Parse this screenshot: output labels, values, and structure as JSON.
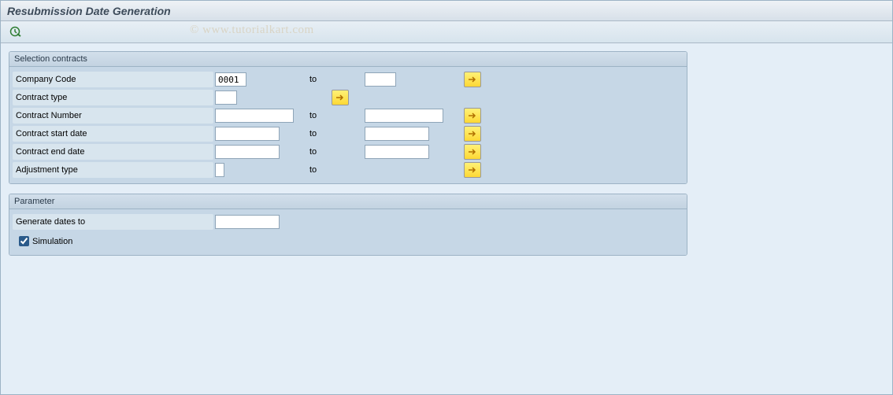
{
  "title": "Resubmission Date Generation",
  "watermark": "© www.tutorialkart.com",
  "groups": {
    "selection": {
      "header": "Selection contracts",
      "fields": {
        "companyCode": {
          "label": "Company Code",
          "from": "0001",
          "to_label": "to",
          "to": ""
        },
        "contractType": {
          "label": "Contract type",
          "from": ""
        },
        "contractNumber": {
          "label": "Contract Number",
          "from": "",
          "to_label": "to",
          "to": ""
        },
        "contractStart": {
          "label": "Contract start date",
          "from": "",
          "to_label": "to",
          "to": ""
        },
        "contractEnd": {
          "label": "Contract end date",
          "from": "",
          "to_label": "to",
          "to": ""
        },
        "adjustmentType": {
          "label": "Adjustment type",
          "from": "",
          "to_label": "to",
          "to": ""
        }
      }
    },
    "parameter": {
      "header": "Parameter",
      "fields": {
        "generateDatesTo": {
          "label": "Generate dates to",
          "value": ""
        },
        "simulation": {
          "label": "Simulation",
          "checked": true
        }
      }
    }
  }
}
